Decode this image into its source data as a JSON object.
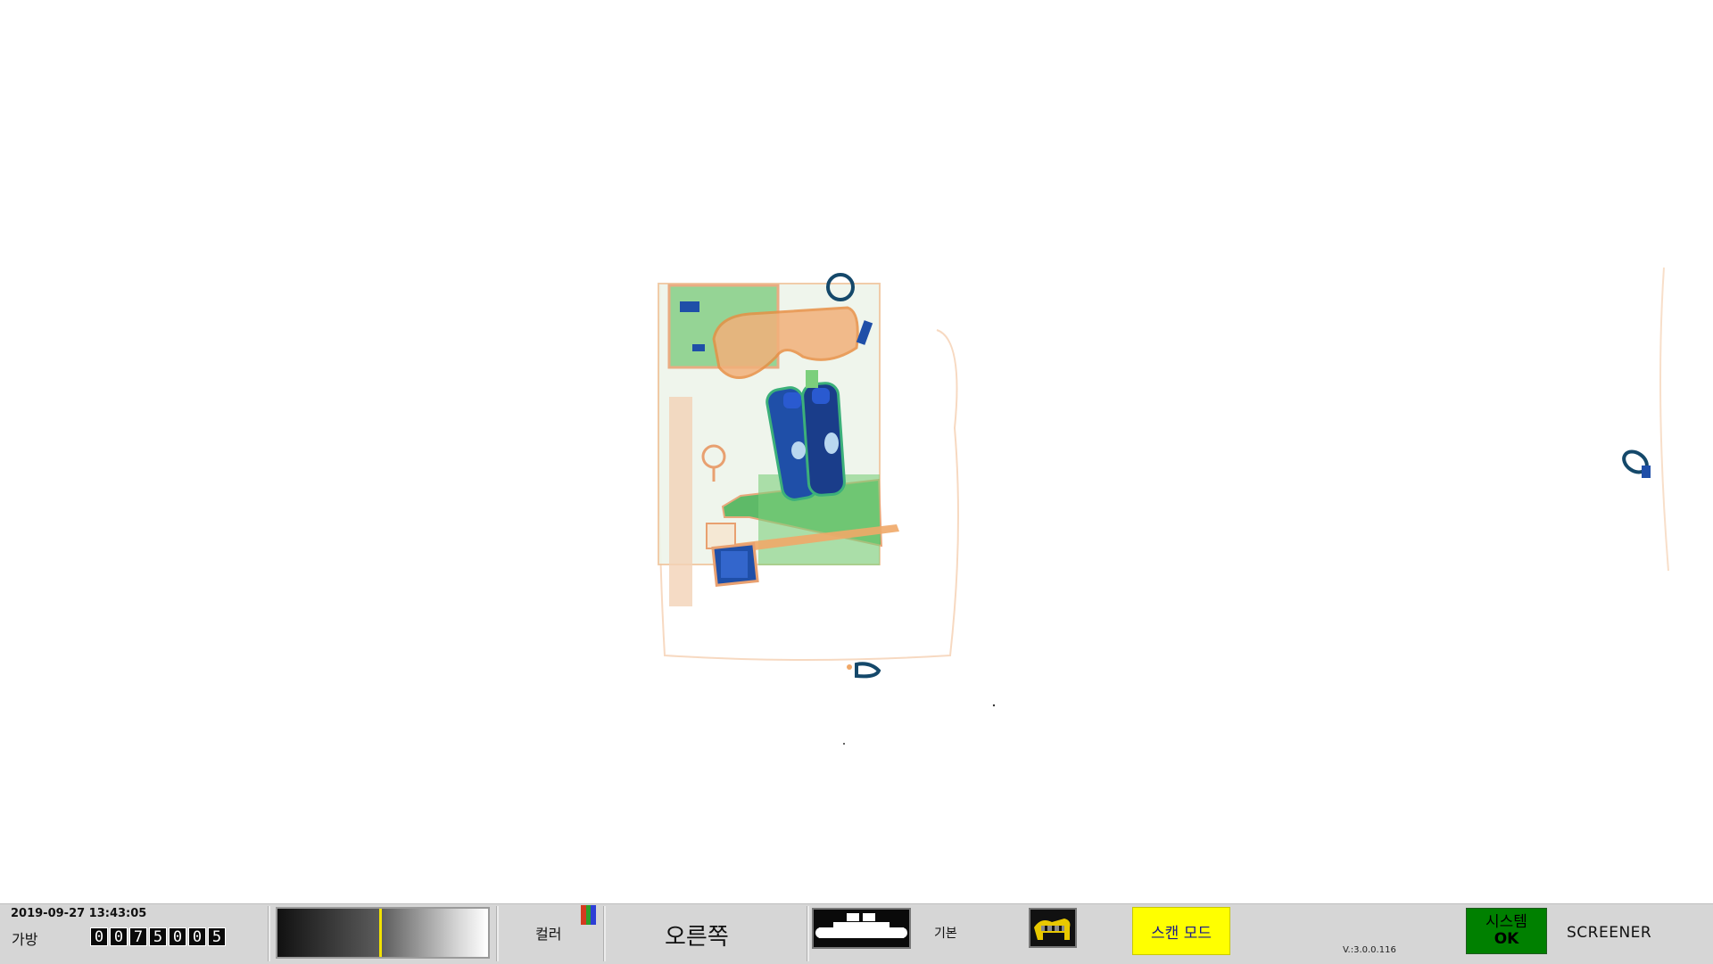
{
  "statusbar": {
    "datetime": "2019-09-27 13:43:05",
    "bag_label": "가방",
    "bag_count_digits": [
      "0",
      "0",
      "7",
      "5",
      "0",
      "0",
      "5"
    ],
    "color_label": "컬러",
    "color_bar_colors": [
      "#d43a1f",
      "#2ba02b",
      "#2d3fd6"
    ],
    "direction_label": "오른쪽",
    "mode_label": "기본",
    "scan_mode_button": "스캔 모드",
    "version": "V.:3.0.0.116",
    "system_status_line1": "시스템",
    "system_status_line2": "OK",
    "user_role": "SCREENER",
    "gradient_marker_fraction": 0.49
  },
  "icons": {
    "gray_gradient": "grayscale-gradient-icon",
    "color_bars": "color-bars-icon",
    "belt": "conveyor-belt-icon",
    "dog": "dog-icon"
  },
  "colors": {
    "scan_mode_bg": "#ffff00",
    "system_ok_bg": "#008000",
    "xray_organic": "#f0a868",
    "xray_inorganic": "#7ccf7c",
    "xray_metal": "#1f4fa8"
  }
}
